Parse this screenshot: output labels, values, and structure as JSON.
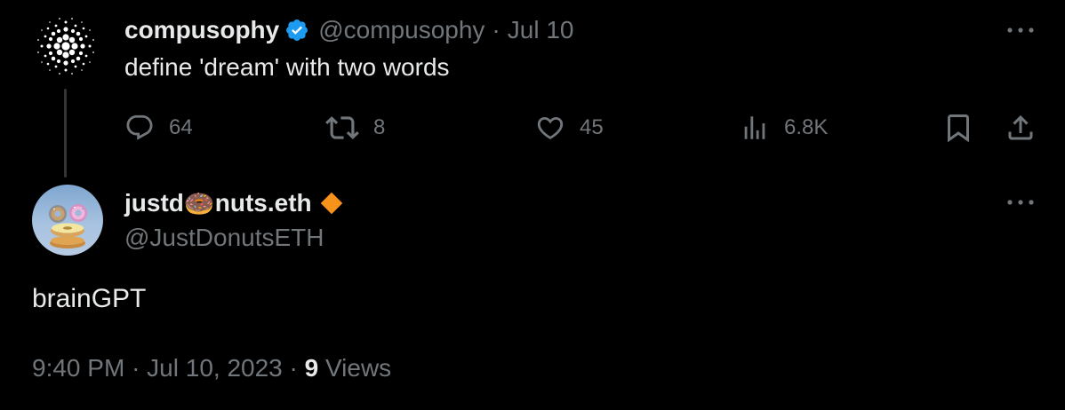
{
  "tweet_original": {
    "display_name": "compusophy",
    "handle": "@compusophy",
    "separator": "·",
    "date": "Jul 10",
    "text": "define 'dream' with two words",
    "avatar_icon": "dotted-sphere-logo",
    "verified_badge_color": "#1d9bf0",
    "actions": {
      "replies": "64",
      "reposts": "8",
      "likes": "45",
      "views": "6.8K"
    }
  },
  "tweet_reply": {
    "display_name_before": "justd",
    "display_name_emoji": "🍩",
    "display_name_after": "nuts.eth",
    "handle": "@JustDonutsETH",
    "badge_color": "#f7931a",
    "avatar_icon": "donut-stack-avatar",
    "text": "brainGPT",
    "time": "9:40 PM",
    "separator": "·",
    "date": "Jul 10, 2023",
    "views_count": "9",
    "views_label": "Views"
  },
  "colors": {
    "background": "#000000",
    "primary_text": "#e7e9ea",
    "secondary_text": "#71767b"
  }
}
